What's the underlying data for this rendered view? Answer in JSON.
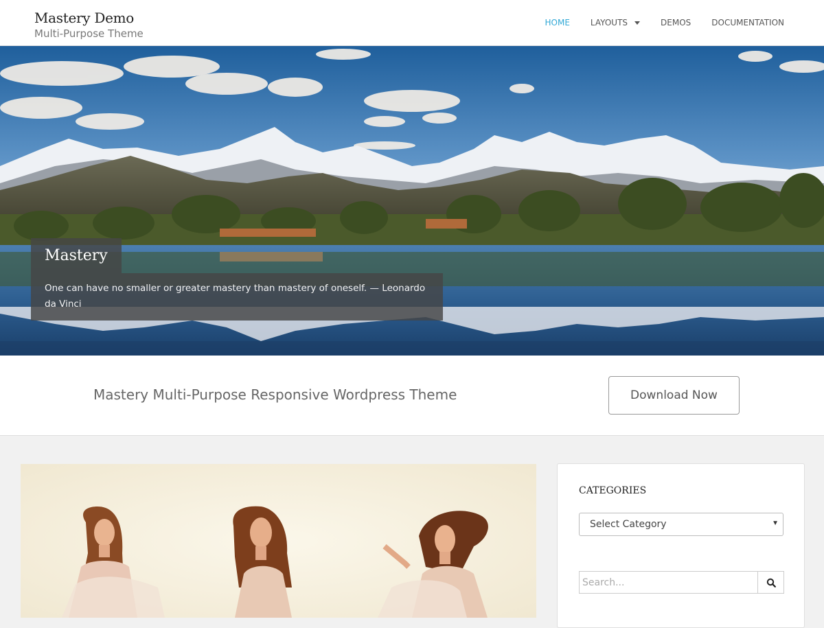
{
  "header": {
    "site_title": "Mastery Demo",
    "tagline": "Multi-Purpose Theme",
    "nav": [
      {
        "label": "HOME",
        "active": true
      },
      {
        "label": "LAYOUTS",
        "has_dropdown": true
      },
      {
        "label": "DEMOS"
      },
      {
        "label": "DOCUMENTATION"
      }
    ],
    "accent_color": "#31a8d6"
  },
  "hero": {
    "title": "Mastery",
    "quote": "One can have no smaller or greater mastery than mastery of oneself. — Leonardo da Vinci"
  },
  "cta": {
    "text": "Mastery Multi-Purpose Responsive Wordpress Theme",
    "button_label": "Download Now"
  },
  "sidebar": {
    "categories_title": "CATEGORIES",
    "category_select_value": "Select Category",
    "search_placeholder": "Search..."
  },
  "icons": {
    "dropdown": "caret-down-icon",
    "select_arrow": "chevron-down-icon",
    "search": "search-icon"
  }
}
